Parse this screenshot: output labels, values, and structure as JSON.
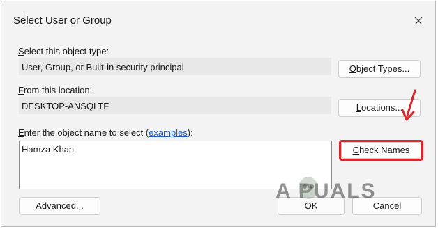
{
  "dialog": {
    "title": "Select User or Group",
    "object_type_label_first": "S",
    "object_type_label_rest": "elect this object type:",
    "object_type_value": "User, Group, or Built-in security principal",
    "object_types_button_first": "O",
    "object_types_button_rest": "bject Types...",
    "location_label_first": "F",
    "location_label_rest": "rom this location:",
    "location_value": "DESKTOP-ANSQLTF",
    "locations_button_first": "L",
    "locations_button_rest": "ocations...",
    "object_name_label_first": "E",
    "object_name_label_rest": "nter the object name to select (",
    "examples_link": "examples",
    "object_name_label_end": "):",
    "object_name_value": "Hamza Khan",
    "check_names_button_first": "C",
    "check_names_button_rest": "heck Names",
    "advanced_button_first": "A",
    "advanced_button_rest": "dvanced...",
    "ok_button": "OK",
    "cancel_button": "Cancel"
  },
  "watermark": {
    "text": "A PUALS"
  },
  "colors": {
    "highlight": "#d9262a",
    "link": "#1f5bb8"
  },
  "icons": {
    "close": "close-icon",
    "annotation_arrow": "red-arrow-icon"
  }
}
